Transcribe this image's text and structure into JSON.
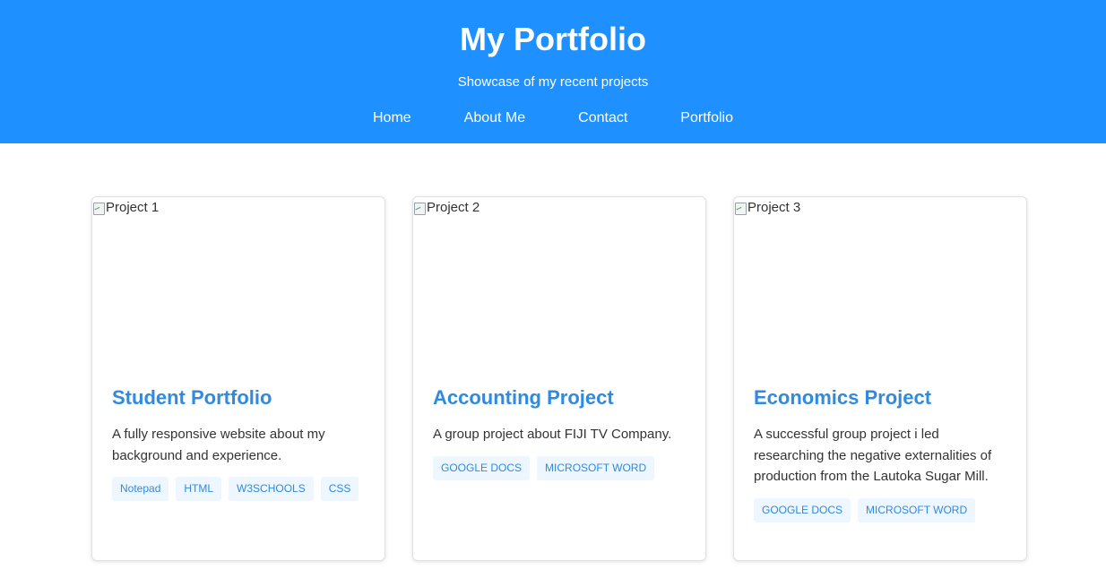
{
  "header": {
    "title": "My Portfolio",
    "subtitle": "Showcase of my recent projects",
    "bg_color": "#1e90ff"
  },
  "nav": {
    "items": [
      "Home",
      "About Me",
      "Contact",
      "Portfolio"
    ]
  },
  "projects": [
    {
      "image_alt": "Project 1",
      "title": "Student Portfolio",
      "description": "A fully responsive website about my background and experience.",
      "tags": [
        "Notepad",
        "HTML",
        "W3SCHOOLS",
        "CSS"
      ]
    },
    {
      "image_alt": "Project 2",
      "title": "Accounting Project",
      "description": "A group project about FIJI TV Company.",
      "tags": [
        "GOOGLE DOCS",
        "MICROSOFT WORD"
      ]
    },
    {
      "image_alt": "Project 3",
      "title": "Economics Project",
      "description": "A successful group project i led researching the negative externalities of production from the Lautoka Sugar Mill.",
      "tags": [
        "GOOGLE DOCS",
        "MICROSOFT WORD"
      ]
    }
  ],
  "colors": {
    "accent": "#2f8ae0",
    "tag_bg": "#eef6ff"
  }
}
